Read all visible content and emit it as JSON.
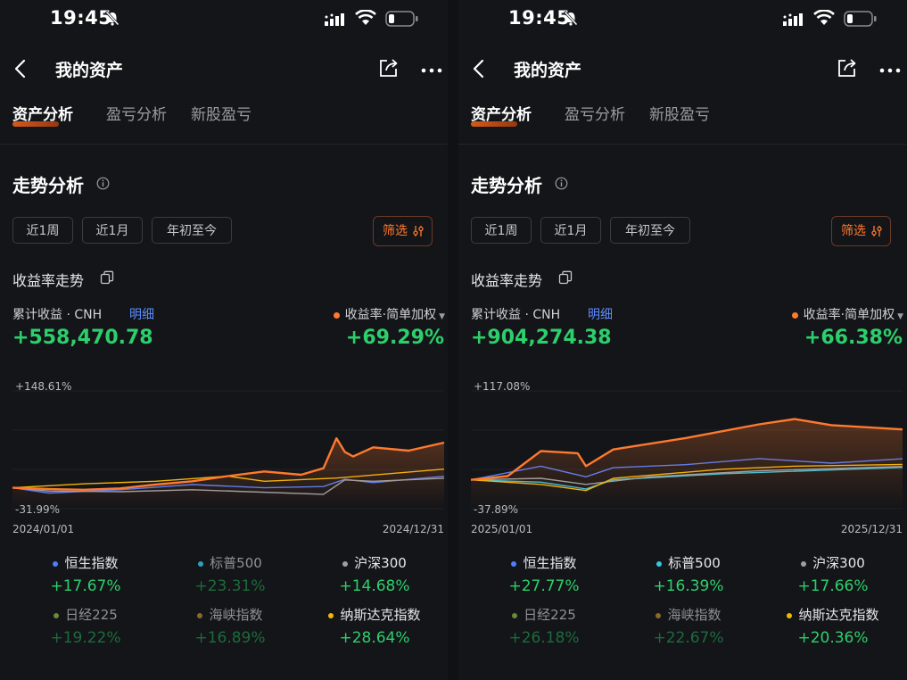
{
  "colors": {
    "accent": "#ff7a2e",
    "positive": "#2ccf6c",
    "link": "#5b8dff",
    "background": "#141518"
  },
  "panels": [
    {
      "status_time": "19:45",
      "nav_title": "我的资产",
      "tabs": [
        "资产分析",
        "盈亏分析",
        "新股盈亏"
      ],
      "section_title": "走势分析",
      "filters": [
        "近1周",
        "近1月",
        "年初至今"
      ],
      "screen_label": "筛选",
      "trend_label": "收益率走势",
      "cum_label": "累计收益 · CNH",
      "detail_label": "明细",
      "rate_label": "收益率·简单加权",
      "cum_value": "+558,470.78",
      "rate_value": "+69.29%",
      "y_max_label": "+148.61%",
      "y_min_label": "-31.99%",
      "x_start_label": "2024/01/01",
      "x_end_label": "2024/12/31",
      "legend": [
        {
          "name": "恒生指数",
          "value": "+17.67%",
          "color": "#4f7dff",
          "dim": false
        },
        {
          "name": "标普500",
          "value": "+23.31%",
          "color": "#2aa3b8",
          "dim": true
        },
        {
          "name": "沪深300",
          "value": "+14.68%",
          "color": "#9aa0a8",
          "dim": false
        },
        {
          "name": "日经225",
          "value": "+19.22%",
          "color": "#6a8a3a",
          "dim": true
        },
        {
          "name": "海峡指数",
          "value": "+16.89%",
          "color": "#8a6a2a",
          "dim": true
        },
        {
          "name": "纳斯达克指数",
          "value": "+28.64%",
          "color": "#f2b705",
          "dim": false
        }
      ]
    },
    {
      "status_time": "19:45",
      "nav_title": "我的资产",
      "tabs": [
        "资产分析",
        "盈亏分析",
        "新股盈亏"
      ],
      "section_title": "走势分析",
      "filters": [
        "近1周",
        "近1月",
        "年初至今"
      ],
      "screen_label": "筛选",
      "trend_label": "收益率走势",
      "cum_label": "累计收益 · CNH",
      "detail_label": "明细",
      "rate_label": "收益率·简单加权",
      "cum_value": "+904,274.38",
      "rate_value": "+66.38%",
      "y_max_label": "+117.08%",
      "y_min_label": "-37.89%",
      "x_start_label": "2025/01/01",
      "x_end_label": "2025/12/31",
      "legend": [
        {
          "name": "恒生指数",
          "value": "+27.77%",
          "color": "#4f7dff",
          "dim": false
        },
        {
          "name": "标普500",
          "value": "+16.39%",
          "color": "#35c6e0",
          "dim": false
        },
        {
          "name": "沪深300",
          "value": "+17.66%",
          "color": "#9aa0a8",
          "dim": false
        },
        {
          "name": "日经225",
          "value": "+26.18%",
          "color": "#6a8a3a",
          "dim": true
        },
        {
          "name": "海峡指数",
          "value": "+22.67%",
          "color": "#8a6a2a",
          "dim": true
        },
        {
          "name": "纳斯达克指数",
          "value": "+20.36%",
          "color": "#f2b705",
          "dim": false
        }
      ]
    }
  ],
  "chart_data": [
    {
      "type": "line",
      "ylim": [
        -31.99,
        148.61
      ],
      "x_range": [
        "2024/01/01",
        "2024/12/31"
      ],
      "series": [
        {
          "name": "收益率·简单加权",
          "color": "#ff7a2e",
          "x": [
            "2024/01/01",
            "2024/02/01",
            "2024/03/01",
            "2024/04/01",
            "2024/05/01",
            "2024/06/01",
            "2024/07/01",
            "2024/08/01",
            "2024/09/01",
            "2024/09/20",
            "2024/10/01",
            "2024/10/08",
            "2024/10/15",
            "2024/11/01",
            "2024/12/01",
            "2024/12/31"
          ],
          "y": [
            0,
            -2,
            -3,
            -1,
            5,
            10,
            18,
            25,
            20,
            30,
            76,
            55,
            48,
            62,
            57,
            69.29
          ]
        },
        {
          "name": "恒生指数",
          "color": "#4f7dff",
          "x": [
            "2024/01/01",
            "2024/02/01",
            "2024/04/01",
            "2024/06/01",
            "2024/08/01",
            "2024/09/20",
            "2024/10/08",
            "2024/11/01",
            "2024/12/31"
          ],
          "y": [
            0,
            -8,
            -3,
            5,
            0,
            2,
            13,
            8,
            17.67
          ]
        },
        {
          "name": "沪深300",
          "color": "#9aa0a8",
          "x": [
            "2024/01/01",
            "2024/02/01",
            "2024/04/01",
            "2024/06/01",
            "2024/09/20",
            "2024/10/08",
            "2024/11/01",
            "2024/12/31"
          ],
          "y": [
            0,
            -5,
            -6,
            -3,
            -10,
            12,
            10,
            14.68
          ]
        },
        {
          "name": "纳斯达克指数",
          "color": "#f2b705",
          "x": [
            "2024/01/01",
            "2024/03/01",
            "2024/05/01",
            "2024/07/01",
            "2024/08/01",
            "2024/10/01",
            "2024/12/31"
          ],
          "y": [
            0,
            6,
            10,
            18,
            10,
            15,
            28.64
          ]
        }
      ]
    },
    {
      "type": "line",
      "ylim": [
        -37.89,
        117.08
      ],
      "x_range": [
        "2025/01/01",
        "2025/12/31"
      ],
      "series": [
        {
          "name": "收益率·简单加权",
          "color": "#ff7a2e",
          "x": [
            "2025/01/01",
            "2025/02/01",
            "2025/03/01",
            "2025/04/01",
            "2025/04/08",
            "2025/05/01",
            "2025/07/01",
            "2025/09/01",
            "2025/10/01",
            "2025/11/01",
            "2025/12/31"
          ],
          "y": [
            0,
            5,
            38,
            35,
            18,
            40,
            55,
            73,
            80,
            72,
            66.38
          ]
        },
        {
          "name": "恒生指数",
          "color": "#4f7dff",
          "x": [
            "2025/01/01",
            "2025/03/01",
            "2025/04/08",
            "2025/05/01",
            "2025/07/01",
            "2025/09/01",
            "2025/11/01",
            "2025/12/31"
          ],
          "y": [
            0,
            18,
            4,
            16,
            20,
            28,
            22,
            27.77
          ]
        },
        {
          "name": "标普500",
          "color": "#35c6e0",
          "x": [
            "2025/01/01",
            "2025/03/01",
            "2025/04/08",
            "2025/05/01",
            "2025/08/01",
            "2025/12/31"
          ],
          "y": [
            0,
            -3,
            -12,
            0,
            8,
            16.39
          ]
        },
        {
          "name": "沪深300",
          "color": "#9aa0a8",
          "x": [
            "2025/01/01",
            "2025/03/01",
            "2025/04/08",
            "2025/06/01",
            "2025/09/01",
            "2025/12/31"
          ],
          "y": [
            0,
            2,
            -6,
            4,
            12,
            17.66
          ]
        },
        {
          "name": "纳斯达克指数",
          "color": "#f2b705",
          "x": [
            "2025/01/01",
            "2025/03/01",
            "2025/04/08",
            "2025/05/01",
            "2025/08/01",
            "2025/10/01",
            "2025/12/31"
          ],
          "y": [
            0,
            -6,
            -14,
            2,
            14,
            18,
            20.36
          ]
        }
      ]
    }
  ]
}
